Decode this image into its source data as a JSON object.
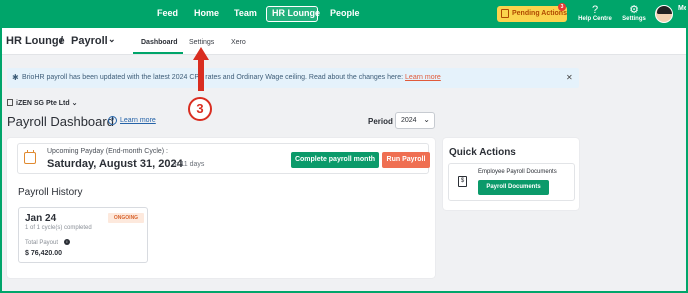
{
  "nav": {
    "items": [
      "Feed",
      "Home",
      "Team",
      "HR Lounge",
      "People"
    ],
    "pending_label": "Pending Actions",
    "pending_count": "3",
    "help_label": "Help Centre",
    "settings_label": "Settings",
    "me_label": "Me"
  },
  "header": {
    "crumb_root": "HR Lounge",
    "crumb_sep": "/",
    "crumb_current": "Payroll",
    "tabs": [
      "Dashboard",
      "Settings",
      "Xero"
    ],
    "active_tab": "Dashboard"
  },
  "banner": {
    "text": "BrioHR payroll has been updated with the latest 2024 CPF rates and Ordinary Wage ceiling. Read about the changes here:",
    "link": "Learn more"
  },
  "company": "iZEN SG Pte Ltd",
  "page": {
    "title": "Payroll Dashboard",
    "learn_more": "Learn more",
    "period_label": "Period",
    "period_value": "2024"
  },
  "payday": {
    "label": "Upcoming Payday (End-month Cycle) :",
    "date": "Saturday, August 31, 2024",
    "in_days": "in 11 days",
    "complete_btn": "Complete payroll month",
    "run_btn": "Run Payroll"
  },
  "history": {
    "title": "Payroll History",
    "month": "Jan 24",
    "status": "ONGOING",
    "cycles": "1 of 1 cycle(s) completed",
    "total_label": "Total Payout",
    "amount": "$ 76,420.00"
  },
  "quick_actions": {
    "title": "Quick Actions",
    "item_label": "Employee Payroll Documents",
    "item_button": "Payroll Documents"
  },
  "annotation": {
    "step": "3"
  },
  "colors": {
    "brand": "#00a56a",
    "accent_orange": "#ef6f52",
    "annotation_red": "#d92d20"
  }
}
